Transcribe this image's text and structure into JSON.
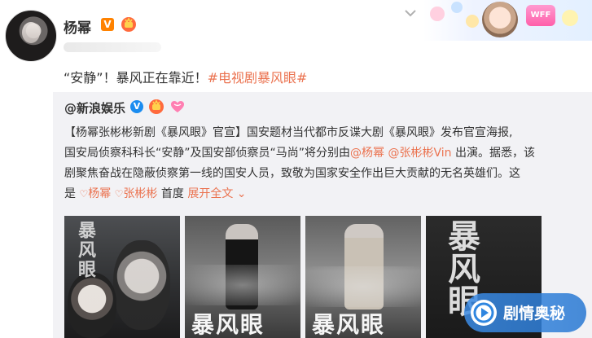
{
  "post": {
    "author": "杨幂",
    "text_plain": "“安静”！暴风正在靠近！",
    "topic": "#电视剧暴风眼#"
  },
  "repost": {
    "author": "@新浪娱乐",
    "line1": "【杨幂张彬彬新剧《暴风眼》官宣】国安题材当代都市反谍大剧《暴风眼》发布官宣海报,",
    "line2_a": "国安局侦察科科长“安静”及国安部侦察员“马尚”将分别由",
    "mention1": "@杨幂",
    "mention2": "@张彬彬Vin",
    "line2_b": "出演。据悉，该",
    "line3": "剧聚焦奋战在隐蔽侦察第一线的国安人员，致敬为国家安全作出巨大贡献的无名英雄们。这",
    "line4_prefix": "是",
    "tag1": "杨幂",
    "tag2": "张彬彬",
    "line4_mid": "首度",
    "expand_label": "展开全文",
    "thumb_titles": [
      "暴风眼",
      "暴风眼",
      "暴风眼",
      "暴风眼"
    ]
  },
  "decor": {
    "wff_label": "WFF"
  },
  "watermark": {
    "label": "剧情奥秘"
  },
  "colors": {
    "link": "#eb7350",
    "repost_bg": "#f2f2f5",
    "vip": "#ff8200",
    "blue_v": "#1a8cf0"
  }
}
